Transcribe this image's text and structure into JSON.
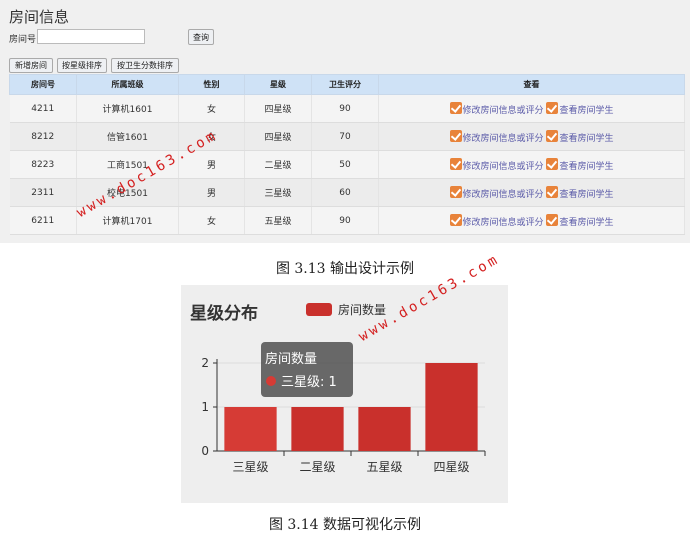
{
  "page": {
    "title": "房间信息",
    "room_no_label": "房间号:",
    "room_no_value": "",
    "query_button": "查询",
    "toolbar": {
      "add_button": "新增房间",
      "sort_star_button": "按星级排序",
      "sort_score_button": "按卫生分数排序"
    },
    "table": {
      "headers": [
        "房间号",
        "所属班级",
        "性别",
        "星级",
        "卫生评分",
        "查看"
      ],
      "rows": [
        {
          "room": "4211",
          "class": "计算机1601",
          "gender": "女",
          "star": "四星级",
          "score": "90",
          "edit": "修改房间信息或评分",
          "view": "查看房间学生"
        },
        {
          "room": "8212",
          "class": "信管1601",
          "gender": "女",
          "star": "四星级",
          "score": "70",
          "edit": "修改房间信息或评分",
          "view": "查看房间学生"
        },
        {
          "room": "8223",
          "class": "工商1501",
          "gender": "男",
          "star": "二星级",
          "score": "50",
          "edit": "修改房间信息或评分",
          "view": "查看房间学生"
        },
        {
          "room": "2311",
          "class": "校电1501",
          "gender": "男",
          "star": "三星级",
          "score": "60",
          "edit": "修改房间信息或评分",
          "view": "查看房间学生"
        },
        {
          "room": "6211",
          "class": "计算机1701",
          "gender": "女",
          "star": "五星级",
          "score": "90",
          "edit": "修改房间信息或评分",
          "view": "查看房间学生"
        }
      ]
    }
  },
  "captions": {
    "fig_313": "图 3.13 输出设计示例",
    "fig_314": "图 3.14 数据可视化示例"
  },
  "chart_data": {
    "type": "bar",
    "title": "星级分布",
    "categories": [
      "三星级",
      "二星级",
      "五星级",
      "四星级"
    ],
    "series": [
      {
        "name": "房间数量",
        "values": [
          1,
          1,
          1,
          2
        ]
      }
    ],
    "ylim": [
      0,
      2
    ],
    "yticks": [
      0,
      1,
      2
    ],
    "grid": true,
    "legend": "top",
    "bar_colors": [
      "#d63b35",
      "#c9302c",
      "#c9302c",
      "#c9302c"
    ],
    "tooltip": {
      "title": "房间数量",
      "label": "三星级",
      "value": "1"
    }
  },
  "colors": {
    "header_bg": "#cfe2f6",
    "bar": "#c9302c",
    "link": "#5a5aa8",
    "check_icon": "#e8833a",
    "watermark": "#d42020"
  },
  "watermarks": [
    "www.doc163.com",
    "www.doc163.com"
  ]
}
